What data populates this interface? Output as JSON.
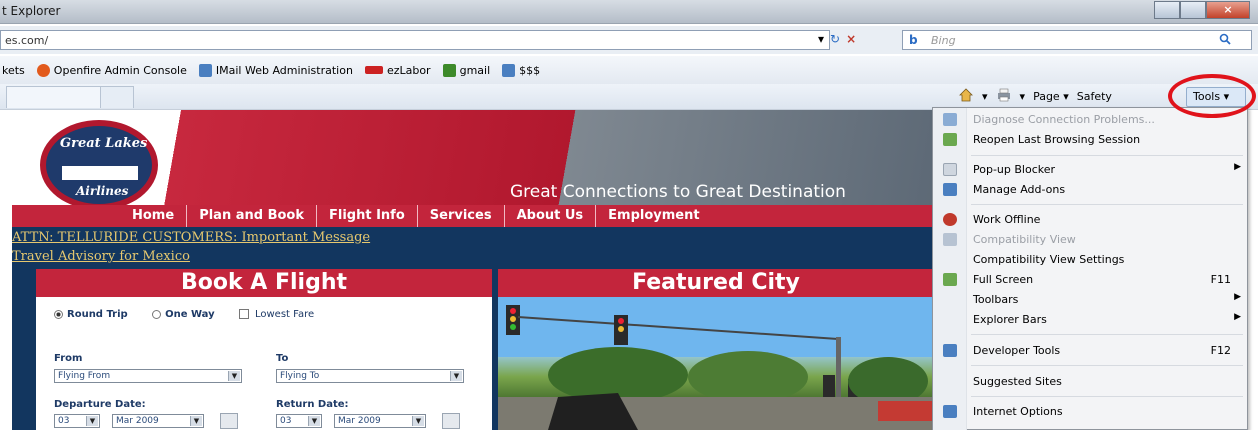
{
  "window": {
    "title": "t Explorer"
  },
  "address": {
    "url": "es.com/",
    "refresh": "↻",
    "stop": "×",
    "dropdown": "▾"
  },
  "search": {
    "logo": "b",
    "placeholder": "Bing",
    "search_icon": "search-icon"
  },
  "favorites": [
    {
      "label": "kets",
      "icon": "none"
    },
    {
      "label": "Openfire Admin Console",
      "icon": "openfire-icon",
      "color": "#e25a1c"
    },
    {
      "label": "IMail Web Administration",
      "icon": "ie-page-icon",
      "color": "#4a7fc0"
    },
    {
      "label": "ezLabor",
      "icon": "ezlabor-icon",
      "color": "#cc2222"
    },
    {
      "label": "gmail",
      "icon": "gmail-icon",
      "color": "#3d8a2a"
    },
    {
      "label": "$$$",
      "icon": "ie-page-icon",
      "color": "#4a7fc0"
    }
  ],
  "command_bar": {
    "home_icon": "home-icon",
    "print_icon": "print-icon",
    "page_label": "Page ▾",
    "safety_label": "Safety",
    "tools_label": "Tools ▾"
  },
  "tools_menu": {
    "items": [
      {
        "label": "Diagnose Connection Problems...",
        "disabled": true,
        "icon": "diagnose-icon",
        "color": "#4a7fc0"
      },
      {
        "label": "Reopen Last Browsing Session",
        "disabled": false,
        "icon": "reopen-icon",
        "color": "#6aa84f"
      },
      {
        "label": "Pop-up Blocker",
        "disabled": false,
        "icon": "popup-blocker-icon",
        "color": "#cfd6df",
        "submenu": true
      },
      {
        "label": "Manage Add-ons",
        "disabled": false,
        "icon": "addons-icon",
        "color": "#4a7fc0"
      },
      {
        "label": "Work Offline",
        "disabled": false,
        "icon": "work-offline-icon",
        "color": "#c0392b"
      },
      {
        "label": "Compatibility View",
        "disabled": true,
        "icon": "compat-view-icon",
        "color": "#b7c3d2"
      },
      {
        "label": "Compatibility View Settings",
        "disabled": false,
        "icon": "none"
      },
      {
        "label": "Full Screen",
        "disabled": false,
        "icon": "fullscreen-icon",
        "color": "#6aa84f",
        "shortcut": "F11"
      },
      {
        "label": "Toolbars",
        "disabled": false,
        "icon": "none",
        "submenu": true
      },
      {
        "label": "Explorer Bars",
        "disabled": false,
        "icon": "none",
        "submenu": true
      },
      {
        "label": "Developer Tools",
        "disabled": false,
        "icon": "developer-tools-icon",
        "color": "#4a7fc0",
        "shortcut": "F12"
      },
      {
        "label": "Suggested Sites",
        "disabled": false,
        "icon": "none"
      },
      {
        "label": "Internet Options",
        "disabled": false,
        "icon": "internet-options-icon",
        "color": "#4a7fc0"
      }
    ],
    "submenu_arrow": "▶"
  },
  "site": {
    "logo": {
      "line1": "Great Lakes",
      "line2": "Airlines"
    },
    "tagline": "Great Connections to Great Destination",
    "nav": [
      "Home",
      "Plan and Book",
      "Flight Info",
      "Services",
      "About Us",
      "Employment"
    ],
    "alerts": [
      "ATTN: TELLURIDE CUSTOMERS: Important Message",
      "Travel Advisory for Mexico"
    ],
    "book_heading": "Book A Flight",
    "featured_heading": "Featured City",
    "form": {
      "trip_round": "Round Trip",
      "trip_one": "One Way",
      "lowest_fare": "Lowest Fare",
      "from_label": "From",
      "to_label": "To",
      "from_value": "Flying From",
      "to_value": "Flying To",
      "departure_label": "Departure Date:",
      "return_label": "Return Date:",
      "dep_day": "03",
      "dep_month": "Mar 2009",
      "ret_day": "03",
      "ret_month": "Mar 2009",
      "dropdown_arrow": "▼"
    }
  }
}
